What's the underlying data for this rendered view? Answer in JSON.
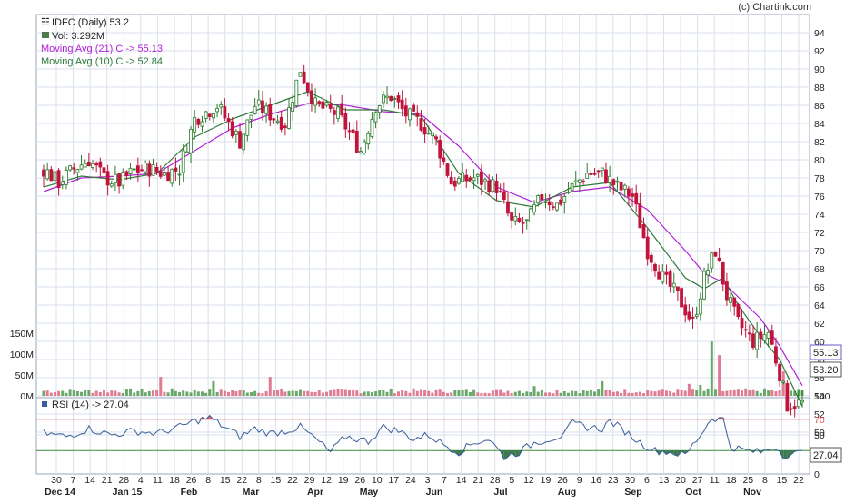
{
  "credit": "(c) Chartink.com",
  "legend": {
    "price": "IDFC (Daily) 53.2",
    "volume": "Vol: 3.292M",
    "ma21": "Moving Avg (21) C -> 55.13",
    "ma10": "Moving Avg (10) C -> 52.84",
    "rsi": "RSI (14) -> 27.04"
  },
  "colors": {
    "up": "#2a7a2a",
    "down": "#c0143c",
    "ma21": "#b21fd8",
    "ma10": "#2f7a3a",
    "rsi_line": "#3a5f9a",
    "rsi_overbought": "#e05050",
    "rsi_oversold": "#3a8f3a",
    "grid": "#d8e1ec",
    "badge_ma21_border": "#6a5acd"
  },
  "chart_data": {
    "type": "candlestick",
    "price_axis": {
      "ticks": [
        "94",
        "92",
        "90",
        "88",
        "86",
        "84",
        "82",
        "80",
        "78",
        "76",
        "74",
        "72",
        "70",
        "68",
        "66",
        "64",
        "62",
        "60",
        "58",
        "56",
        "54",
        "52",
        "50"
      ]
    },
    "volume_axis": {
      "ticks": [
        "150M",
        "100M",
        "50M",
        "0M"
      ]
    },
    "rsi_axis": {
      "ticks": [
        "100",
        "70",
        "50",
        "30",
        "0"
      ],
      "overbought": 70,
      "oversold": 30
    },
    "x_ticks": [
      "30",
      "7",
      "14",
      "21",
      "28",
      "4",
      "11",
      "18",
      "26",
      "8",
      "15",
      "22",
      "8",
      "15",
      "22",
      "29",
      "12",
      "19",
      "26",
      "10",
      "17",
      "24",
      "3",
      "7",
      "14",
      "21",
      "28",
      "5",
      "12",
      "19",
      "26",
      "9",
      "16",
      "23",
      "30",
      "6",
      "13",
      "20",
      "27",
      "11",
      "18",
      "25",
      "8",
      "15",
      "22"
    ],
    "month_labels": [
      "Dec 14",
      "Jan 15",
      "Feb",
      "Mar",
      "Apr",
      "May",
      "Jun",
      "Jul",
      "Aug",
      "Sep",
      "Oct",
      "Nov"
    ],
    "last_close": "53.20",
    "ma21_last": "55.13",
    "ma10_last": 52.84,
    "rsi_last": "27.04",
    "close_anchors": [
      [
        0,
        79
      ],
      [
        4,
        77.5
      ],
      [
        8,
        79
      ],
      [
        12,
        80
      ],
      [
        16,
        78
      ],
      [
        20,
        77.5
      ],
      [
        24,
        78.8
      ],
      [
        28,
        79
      ],
      [
        32,
        78.5
      ],
      [
        36,
        79
      ],
      [
        40,
        84.5
      ],
      [
        46,
        86
      ],
      [
        52,
        82
      ],
      [
        56,
        86
      ],
      [
        60,
        85
      ],
      [
        64,
        84
      ],
      [
        68,
        90
      ],
      [
        72,
        86
      ],
      [
        78,
        85
      ],
      [
        84,
        81
      ],
      [
        88,
        86
      ],
      [
        92,
        87
      ],
      [
        96,
        85
      ],
      [
        100,
        84
      ],
      [
        104,
        82
      ],
      [
        108,
        77.5
      ],
      [
        114,
        78
      ],
      [
        120,
        77
      ],
      [
        124,
        73
      ],
      [
        128,
        73
      ],
      [
        132,
        76
      ],
      [
        136,
        75
      ],
      [
        140,
        77
      ],
      [
        144,
        78.5
      ],
      [
        148,
        78.5
      ],
      [
        152,
        77
      ],
      [
        156,
        76
      ],
      [
        160,
        70
      ],
      [
        164,
        67
      ],
      [
        168,
        65
      ],
      [
        172,
        62
      ],
      [
        175,
        67
      ],
      [
        178,
        70
      ],
      [
        181,
        65
      ],
      [
        184,
        62
      ],
      [
        188,
        60
      ],
      [
        192,
        61
      ],
      [
        195,
        56.5
      ],
      [
        197,
        53
      ],
      [
        201,
        53.2
      ]
    ],
    "ma21_anchors": [
      [
        0,
        76.5
      ],
      [
        10,
        78
      ],
      [
        20,
        78.2
      ],
      [
        30,
        78.5
      ],
      [
        40,
        81
      ],
      [
        50,
        83.5
      ],
      [
        60,
        85
      ],
      [
        70,
        86.2
      ],
      [
        80,
        86
      ],
      [
        90,
        85.3
      ],
      [
        100,
        85
      ],
      [
        110,
        81.5
      ],
      [
        120,
        77
      ],
      [
        130,
        75.3
      ],
      [
        140,
        76.5
      ],
      [
        150,
        77
      ],
      [
        160,
        74.5
      ],
      [
        170,
        70
      ],
      [
        175,
        67.5
      ],
      [
        180,
        66.5
      ],
      [
        185,
        64.5
      ],
      [
        190,
        62.5
      ],
      [
        195,
        59.5
      ],
      [
        201,
        55.13
      ]
    ],
    "ma10_anchors": [
      [
        0,
        77
      ],
      [
        10,
        78.2
      ],
      [
        20,
        77.8
      ],
      [
        30,
        78.5
      ],
      [
        40,
        82.5
      ],
      [
        50,
        84.5
      ],
      [
        60,
        86
      ],
      [
        70,
        87.5
      ],
      [
        80,
        85.5
      ],
      [
        90,
        85.5
      ],
      [
        100,
        84.8
      ],
      [
        110,
        78.5
      ],
      [
        120,
        75.5
      ],
      [
        130,
        74.8
      ],
      [
        140,
        77
      ],
      [
        150,
        77.5
      ],
      [
        160,
        72.5
      ],
      [
        170,
        67
      ],
      [
        175,
        65.8
      ],
      [
        180,
        67
      ],
      [
        184,
        64
      ],
      [
        190,
        60.5
      ],
      [
        195,
        58
      ],
      [
        201,
        52.84
      ]
    ],
    "rsi_anchors": [
      [
        0,
        52
      ],
      [
        6,
        48
      ],
      [
        12,
        58
      ],
      [
        18,
        50
      ],
      [
        24,
        55
      ],
      [
        30,
        52
      ],
      [
        36,
        60
      ],
      [
        40,
        68
      ],
      [
        44,
        72
      ],
      [
        48,
        60
      ],
      [
        52,
        48
      ],
      [
        56,
        58
      ],
      [
        60,
        52
      ],
      [
        64,
        55
      ],
      [
        68,
        60
      ],
      [
        72,
        45
      ],
      [
        76,
        28
      ],
      [
        80,
        48
      ],
      [
        86,
        42
      ],
      [
        90,
        60
      ],
      [
        94,
        55
      ],
      [
        98,
        45
      ],
      [
        102,
        50
      ],
      [
        106,
        38
      ],
      [
        110,
        28
      ],
      [
        114,
        40
      ],
      [
        118,
        45
      ],
      [
        122,
        22
      ],
      [
        126,
        28
      ],
      [
        130,
        40
      ],
      [
        134,
        45
      ],
      [
        138,
        50
      ],
      [
        140,
        65
      ],
      [
        144,
        60
      ],
      [
        148,
        58
      ],
      [
        150,
        68
      ],
      [
        154,
        55
      ],
      [
        158,
        40
      ],
      [
        162,
        30
      ],
      [
        166,
        28
      ],
      [
        170,
        24
      ],
      [
        174,
        50
      ],
      [
        177,
        72
      ],
      [
        180,
        70
      ],
      [
        182,
        35
      ],
      [
        186,
        30
      ],
      [
        190,
        28
      ],
      [
        194,
        35
      ],
      [
        196,
        24
      ],
      [
        201,
        27.04
      ]
    ],
    "volume_spikes": [
      [
        31,
        0.35
      ],
      [
        45,
        0.27
      ],
      [
        60,
        0.35
      ],
      [
        130,
        0.18
      ],
      [
        148,
        0.27
      ],
      [
        171,
        0.22
      ],
      [
        174,
        0.2
      ],
      [
        177,
        1.0
      ],
      [
        179,
        0.75
      ],
      [
        196,
        0.45
      ]
    ],
    "volume_base_m": 12,
    "bars": 202
  }
}
